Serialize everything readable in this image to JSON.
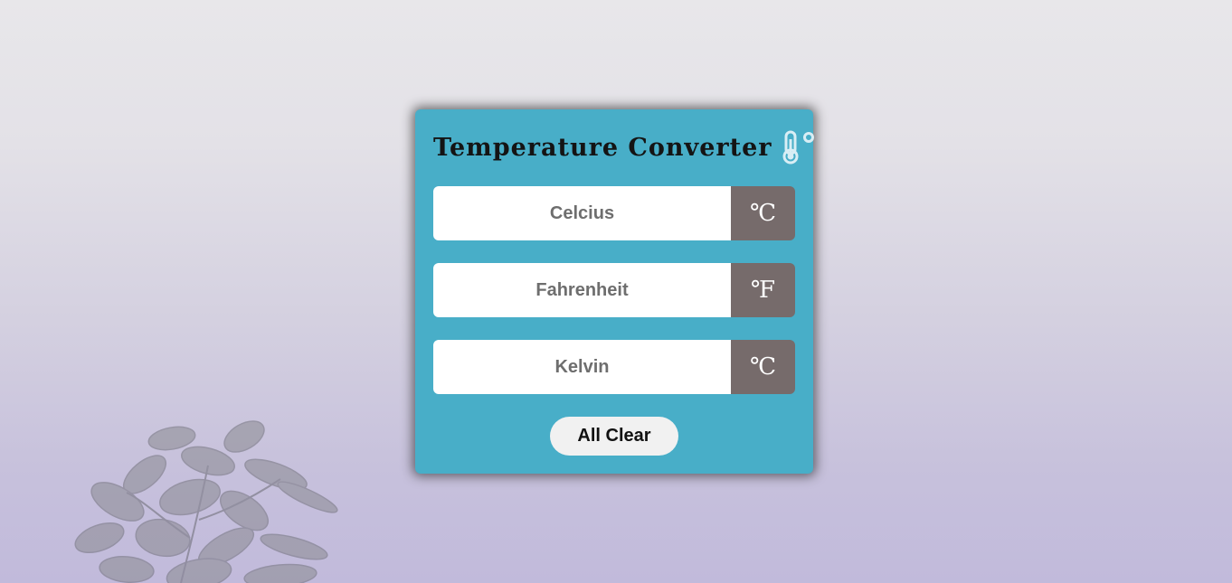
{
  "app": {
    "title": "Temperature Converter",
    "title_icon": "thermometer-degree-icon"
  },
  "fields": [
    {
      "name": "celsius",
      "value": "",
      "placeholder": "Celcius",
      "unit": "℃"
    },
    {
      "name": "fahrenheit",
      "value": "",
      "placeholder": "Fahrenheit",
      "unit": "℉"
    },
    {
      "name": "kelvin",
      "value": "",
      "placeholder": "Kelvin",
      "unit": "℃"
    }
  ],
  "actions": {
    "clear_label": "All Clear"
  },
  "colors": {
    "card_background": "#48aec8",
    "unit_background": "#766b6b",
    "input_text": "#6e6e6e",
    "button_background": "#f1f1f1"
  },
  "background": {
    "decoration": "plant-image"
  }
}
